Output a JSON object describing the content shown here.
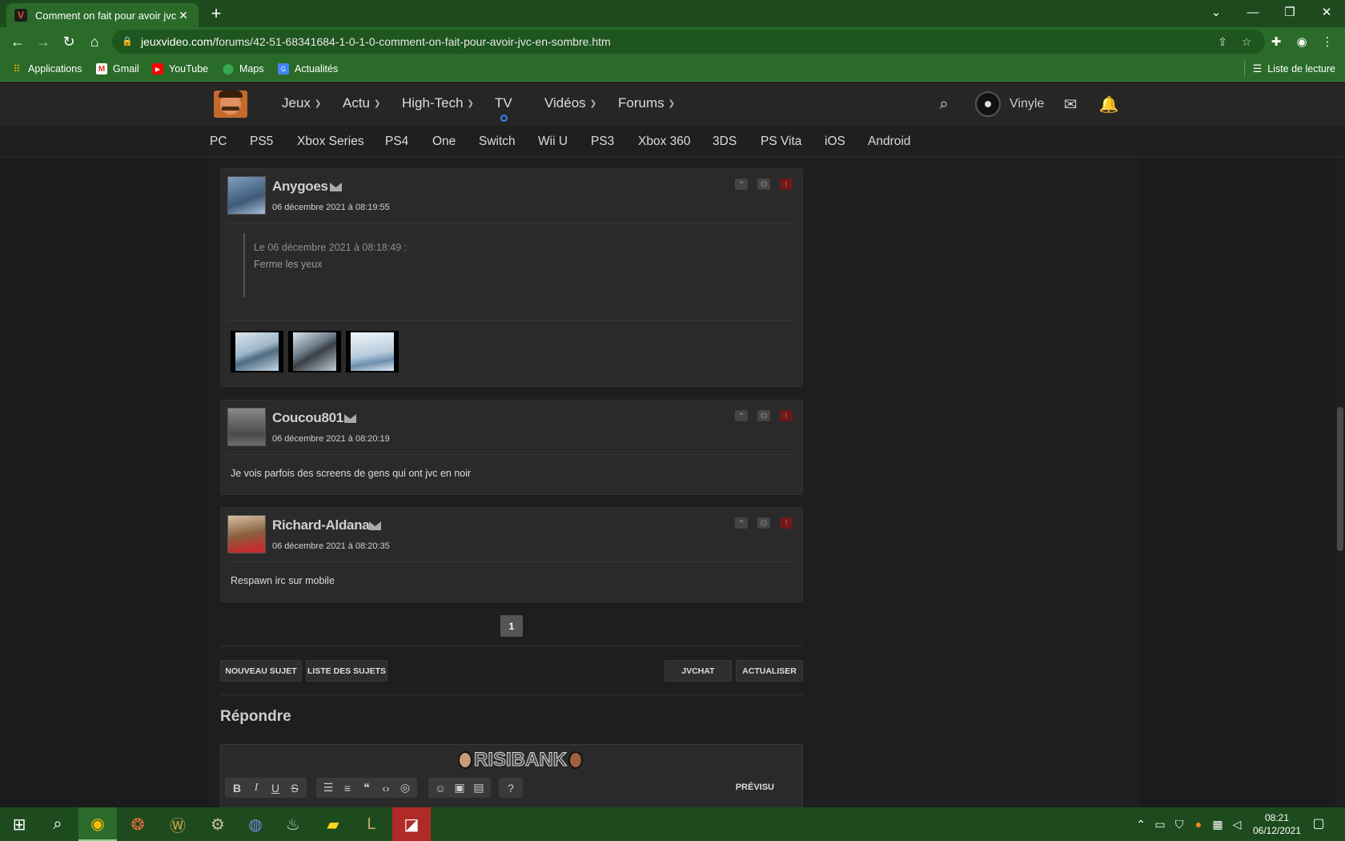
{
  "browser": {
    "tab_title": "Comment on fait pour avoir jvc e",
    "new_tab": "+",
    "url_host": "jeuxvideo.com",
    "url_path": "/forums/42-51-68341684-1-0-1-0-comment-on-fait-pour-avoir-jvc-en-sombre.htm",
    "bookmarks": [
      "Applications",
      "Gmail",
      "YouTube",
      "Maps",
      "Actualités"
    ],
    "reading_list": "Liste de lecture"
  },
  "site": {
    "nav": [
      "Jeux",
      "Actu",
      "High-Tech",
      "TV",
      "Vidéos",
      "Forums"
    ],
    "username": "Vinyle",
    "platforms": [
      "PC",
      "PS5",
      "Xbox Series",
      "PS4",
      "One",
      "Switch",
      "Wii U",
      "PS3",
      "Xbox 360",
      "3DS",
      "PS Vita",
      "iOS",
      "Android"
    ]
  },
  "posts": [
    {
      "author": "Anygoes",
      "date": "06 décembre 2021 à 08:19:55",
      "quote_header": "Le 06 décembre 2021 à 08:18:49 :",
      "quote_text": "Ferme les yeux",
      "avatar_color": "#5d7ea0"
    },
    {
      "author": "Coucou801",
      "date": "06 décembre 2021 à 08:20:19",
      "text": "Je vois parfois des screens de gens qui ont jvc en noir",
      "avatar_color": "#6a6a6a"
    },
    {
      "author": "Richard-Aldana",
      "date": "06 décembre 2021 à 08:20:35",
      "text": "Respawn irc sur mobile",
      "avatar_color": "#9a7a5a"
    }
  ],
  "pagination": {
    "current": "1"
  },
  "buttons": {
    "new_topic": "NOUVEAU SUJET",
    "topic_list": "LISTE DES SUJETS",
    "jvchat": "JVCHAT",
    "refresh": "ACTUALISER"
  },
  "reply": {
    "title": "Répondre",
    "risibank": "RISIBANK",
    "preview": "PRÉVISU"
  },
  "taskbar": {
    "time": "08:21",
    "date": "06/12/2021"
  },
  "colors": {
    "chrome_green": "#2a6b2a",
    "chrome_dark_green": "#1e4b1e",
    "site_header": "#262626",
    "post_bg": "#2a2a2a",
    "alert_red": "#6b1a1a"
  }
}
